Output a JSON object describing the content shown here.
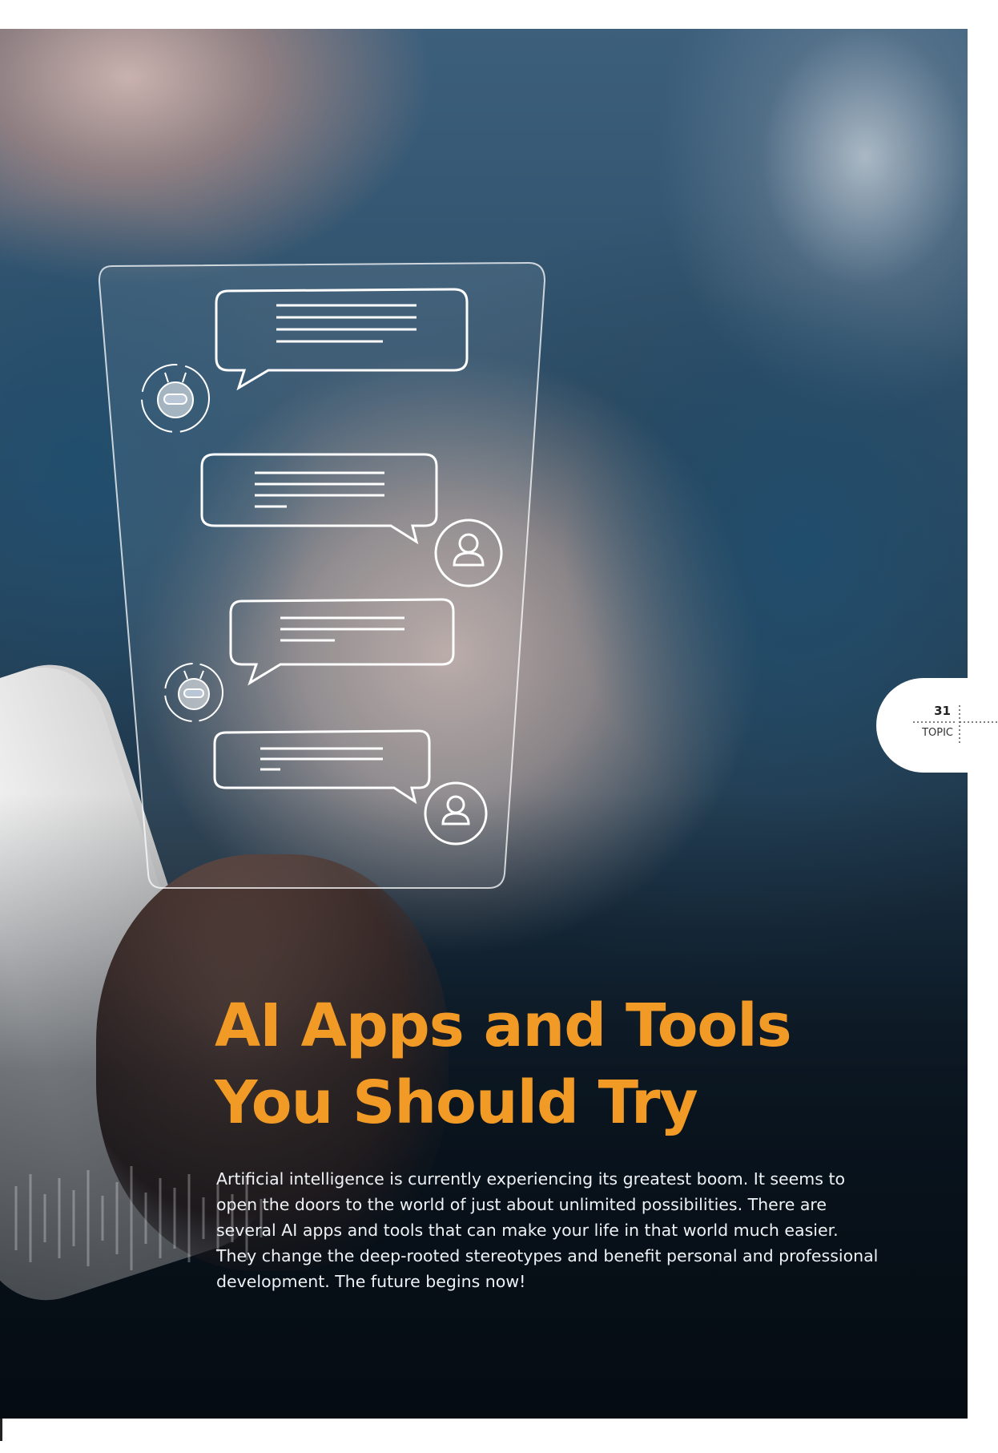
{
  "article": {
    "title_line1": "AI Apps and Tools",
    "title_line2": "You Should Try",
    "intro": "Artificial intelligence is currently experiencing its greatest boom. It seems to open the doors to the world of just about unlimited possibilities. There are several AI apps and tools that can make your life in that world much easier. They change the deep-rooted stereotypes and benefit personal and professional development. The future begins now!"
  },
  "page_tab": {
    "page_number": "31",
    "section": "TOPIC"
  },
  "colors": {
    "title": "#f29a26",
    "intro_text": "#eef2f5",
    "tab_background": "#ffffff"
  },
  "illustration": {
    "messages": [
      {
        "from": "bot",
        "icon": "robot-icon"
      },
      {
        "from": "user",
        "icon": "user-icon"
      },
      {
        "from": "bot",
        "icon": "robot-icon"
      },
      {
        "from": "user",
        "icon": "user-icon"
      }
    ]
  }
}
